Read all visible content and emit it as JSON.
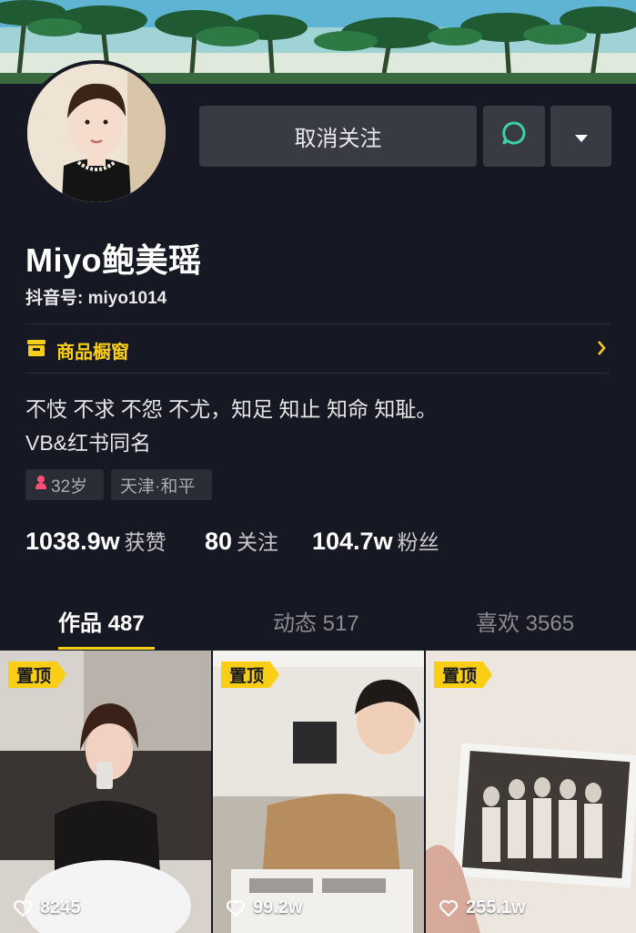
{
  "header": {
    "unfollow_label": "取消关注",
    "message_icon": "chat-bubble-icon",
    "more_icon": "triangle-down-icon"
  },
  "profile": {
    "name": "Miyo鲍美瑶",
    "douyin_id": "抖音号: miyo1014",
    "shop_label": "商品橱窗",
    "bio_line1": "不忮 不求 不怨 不尤，知足 知止 知命 知耻。",
    "bio_line2": "VB&红书同名",
    "age_tag": "32岁",
    "location_tag": "天津·和平"
  },
  "stats": {
    "likes_num": "1038.9w",
    "likes_label": "获赞",
    "following_num": "80",
    "following_label": "关注",
    "followers_num": "104.7w",
    "followers_label": "粉丝"
  },
  "tabs": [
    {
      "label": "作品 487",
      "active": true
    },
    {
      "label": "动态 517",
      "active": false
    },
    {
      "label": "喜欢 3565",
      "active": false
    }
  ],
  "videos": [
    {
      "pin_label": "置顶",
      "likes": "8245"
    },
    {
      "pin_label": "置顶",
      "likes": "99.2w"
    },
    {
      "pin_label": "置顶",
      "likes": "255.1w"
    }
  ],
  "colors": {
    "background": "#161823",
    "accent": "#face15",
    "button": "#393b44",
    "message_icon": "#3fd0a8"
  }
}
